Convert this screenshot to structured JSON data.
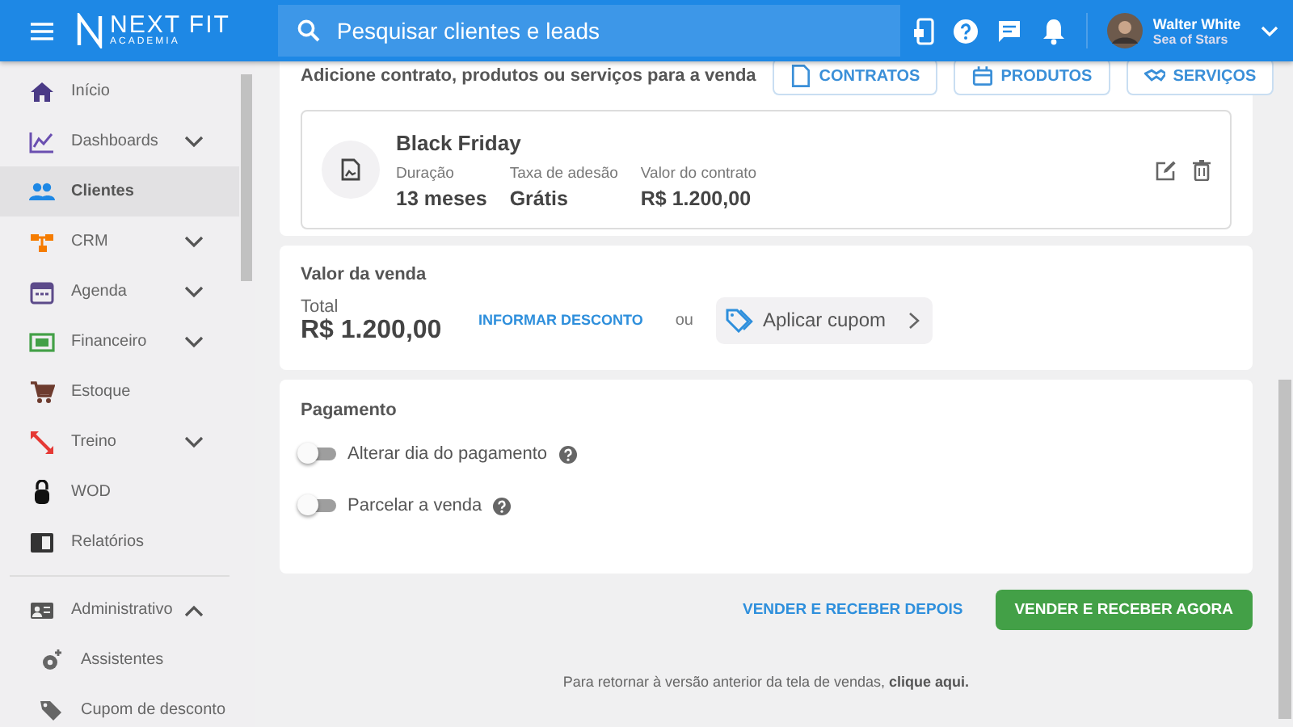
{
  "header": {
    "brand": "NEXT FIT",
    "brand_sub": "ACADEMIA",
    "search": {
      "placeholder": "Pesquisar clientes e leads"
    },
    "user": {
      "name": "Walter White",
      "org": "Sea of Stars"
    }
  },
  "sidebar": {
    "items": [
      {
        "label": "Início",
        "selected": false
      },
      {
        "label": "Dashboards",
        "selected": false,
        "expanded": false
      },
      {
        "label": "Clientes",
        "selected": true
      },
      {
        "label": "CRM",
        "selected": false,
        "expanded": false
      },
      {
        "label": "Agenda",
        "selected": false,
        "expanded": false
      },
      {
        "label": "Financeiro",
        "selected": false,
        "expanded": false
      },
      {
        "label": "Estoque",
        "selected": false
      },
      {
        "label": "Treino",
        "selected": false,
        "expanded": false
      },
      {
        "label": "WOD",
        "selected": false
      },
      {
        "label": "Relatórios",
        "selected": false
      },
      {
        "label": "Administrativo",
        "selected": false,
        "expanded": true,
        "children": [
          {
            "label": "Assistentes",
            "selected": false
          },
          {
            "label": "Cupom de desconto",
            "selected": false
          }
        ]
      }
    ]
  },
  "items_section": {
    "title": "Adicione contrato, produtos ou serviços para a venda",
    "buttons": [
      "CONTRATOS",
      "PRODUTOS",
      "SERVIÇOS"
    ],
    "contract": {
      "name": "Black Friday",
      "fields": [
        {
          "label": "Duração",
          "value": "13 meses"
        },
        {
          "label": "Taxa de adesão",
          "value": "Grátis"
        },
        {
          "label": "Valor do contrato",
          "value": "R$ 1.200,00"
        }
      ]
    }
  },
  "sale_value": {
    "title": "Valor da venda",
    "total_label": "Total",
    "total": "R$ 1.200,00",
    "discount_link": "INFORMAR DESCONTO",
    "or": "ou",
    "coupon": "Aplicar cupom"
  },
  "payment": {
    "title": "Pagamento",
    "options": [
      {
        "label": "Alterar dia do pagamento",
        "on": false
      },
      {
        "label": "Parcelar a venda",
        "on": false
      }
    ]
  },
  "actions": {
    "secondary": "VENDER E RECEBER DEPOIS",
    "primary": "VENDER E RECEBER AGORA"
  },
  "footer": {
    "text": "Para retornar à versão anterior da tela de vendas,",
    "link": "clique aqui."
  }
}
